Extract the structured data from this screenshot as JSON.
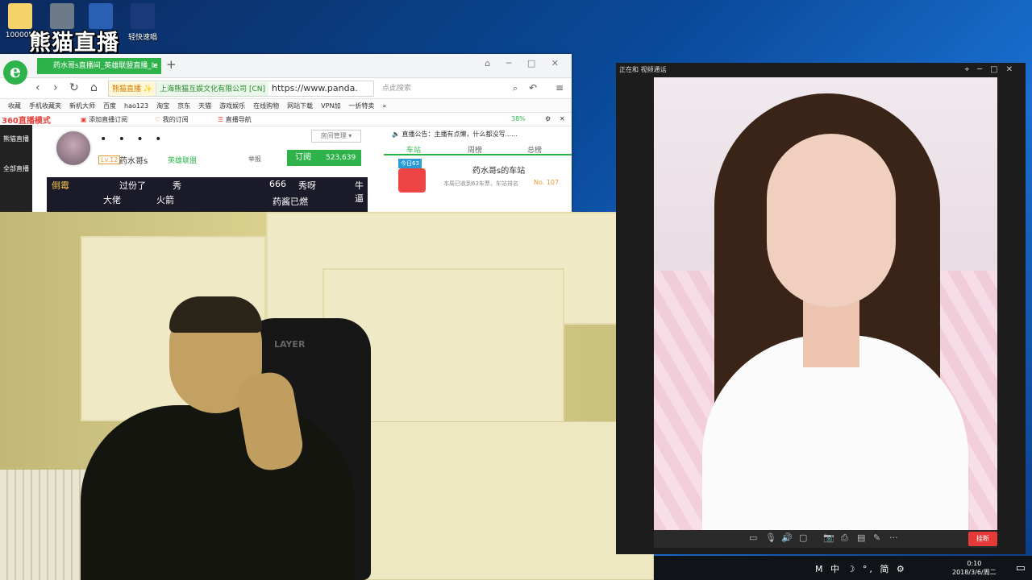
{
  "desktop": {
    "icons": [
      {
        "label": "10000M"
      },
      {
        "label": ""
      },
      {
        "label": ""
      },
      {
        "label": "轻快速唱"
      }
    ],
    "logo": "熊猫直播"
  },
  "browser": {
    "tab_title": "药水哥s直播间_英雄联盟直播_le",
    "tab_close": "×",
    "tab_add": "+",
    "address": {
      "badge1": "熊猫直播 ✨",
      "badge2": "上海熊猫互娱文化有限公司 [CN]",
      "url": "https://www.panda."
    },
    "search_placeholder": "点此搜索",
    "favorites": [
      "收藏",
      "手机收藏夹",
      "新机大师",
      "百度",
      "hao123",
      "淘宝",
      "京东",
      "天猫",
      "游戏娱乐",
      "在线购物",
      "网站下载",
      "VPN加",
      "一折特卖",
      "»"
    ],
    "ext_bar": {
      "label_360": "360直播模式",
      "add_sub": "添加直播订阅",
      "my_sub": "我的订阅",
      "nav": "直播导航",
      "percent": "38%"
    }
  },
  "stream_page": {
    "leftnav": {
      "top": "熊猫直播",
      "bottom": "全部直播"
    },
    "title_dots": "• • • •",
    "level": "Lv.12",
    "streamer_name": "药水哥s",
    "category": "英雄联盟",
    "report": "举报",
    "room_select": "房间管理 ▾",
    "subscribe_label": "订阅",
    "subscribe_count": "523,639",
    "video_overlay": [
      "倒霉",
      "过份了",
      "秀",
      "666",
      "秀呀",
      "牛逼",
      "大佬",
      "火箭",
      "药酱已燃"
    ],
    "notice": "直播公告：主播有点懒，什么都没写......",
    "tabs": [
      "车站",
      "周榜",
      "总榜"
    ],
    "station_badge": "今日63",
    "station_title": "药水哥s的车站",
    "station_sub": "本周已收到63车票，车站排名",
    "station_rank": "No. 107"
  },
  "call_window": {
    "title": "正在和  视频通话",
    "controls": [
      "⌖",
      "─",
      "□",
      "✕"
    ],
    "toolbar_icons": [
      "chat-icon",
      "mic-icon",
      "speaker-icon",
      "camera-icon",
      "screenshot-icon",
      "record-icon",
      "layout-icon",
      "edit-icon",
      "more-icon"
    ],
    "toolbar_glyphs": [
      "▭",
      "🎙",
      "🔊",
      "▢",
      "📷",
      "⎙",
      "▤",
      "✎",
      "···"
    ],
    "hangup_label": "挂断"
  },
  "taskbar": {
    "tray": "M 中 ☽ °, 简 ⚙",
    "time": "0:10",
    "date": "2018/3/6/周二"
  },
  "webcam": {
    "chair_brand": "LAYER"
  },
  "colors": {
    "accent": "#2db34a",
    "hangup": "#e6393a"
  }
}
